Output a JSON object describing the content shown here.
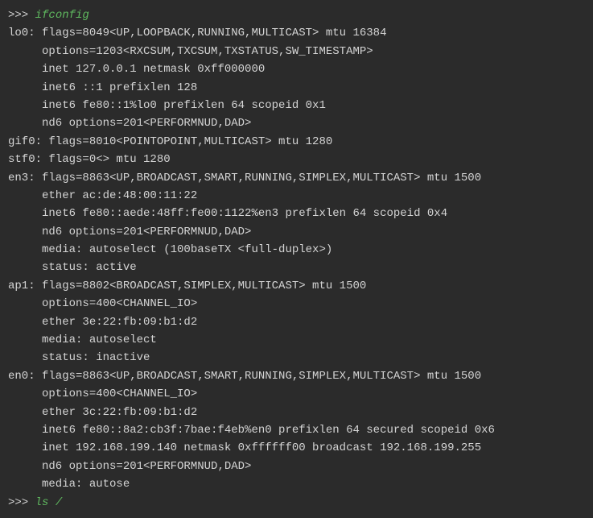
{
  "prompt_symbol": ">>> ",
  "commands": {
    "first": "ifconfig",
    "second": "ls /"
  },
  "output_lines": [
    "lo0: flags=8049<UP,LOOPBACK,RUNNING,MULTICAST> mtu 16384",
    "     options=1203<RXCSUM,TXCSUM,TXSTATUS,SW_TIMESTAMP>",
    "     inet 127.0.0.1 netmask 0xff000000",
    "     inet6 ::1 prefixlen 128",
    "     inet6 fe80::1%lo0 prefixlen 64 scopeid 0x1",
    "     nd6 options=201<PERFORMNUD,DAD>",
    "gif0: flags=8010<POINTOPOINT,MULTICAST> mtu 1280",
    "stf0: flags=0<> mtu 1280",
    "en3: flags=8863<UP,BROADCAST,SMART,RUNNING,SIMPLEX,MULTICAST> mtu 1500",
    "     ether ac:de:48:00:11:22",
    "     inet6 fe80::aede:48ff:fe00:1122%en3 prefixlen 64 scopeid 0x4",
    "     nd6 options=201<PERFORMNUD,DAD>",
    "     media: autoselect (100baseTX <full-duplex>)",
    "     status: active",
    "ap1: flags=8802<BROADCAST,SIMPLEX,MULTICAST> mtu 1500",
    "     options=400<CHANNEL_IO>",
    "     ether 3e:22:fb:09:b1:d2",
    "     media: autoselect",
    "     status: inactive",
    "en0: flags=8863<UP,BROADCAST,SMART,RUNNING,SIMPLEX,MULTICAST> mtu 1500",
    "     options=400<CHANNEL_IO>",
    "     ether 3c:22:fb:09:b1:d2",
    "     inet6 fe80::8a2:cb3f:7bae:f4eb%en0 prefixlen 64 secured scopeid 0x6",
    "     inet 192.168.199.140 netmask 0xffffff00 broadcast 192.168.199.255",
    "     nd6 options=201<PERFORMNUD,DAD>",
    "     media: autose"
  ]
}
